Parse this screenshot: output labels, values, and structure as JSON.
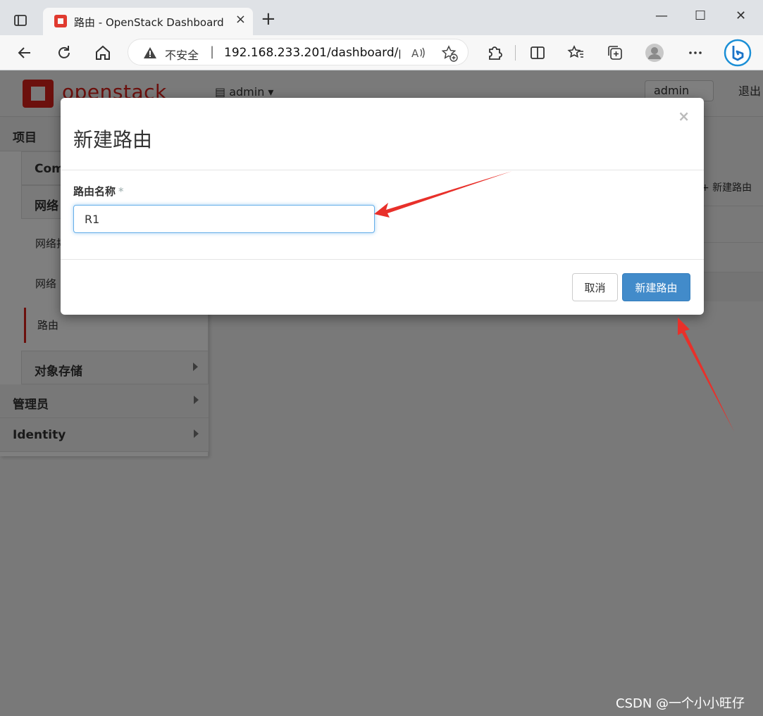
{
  "browser": {
    "tab_title": "路由 - OpenStack Dashboard",
    "tab_close": "×",
    "new_tab": "+",
    "url_warning": "不安全",
    "url_separator": "|",
    "url": "192.168.233.201/dashboard/pr...",
    "window_minimize": "—",
    "window_maximize": "☐",
    "window_close": "✕"
  },
  "header": {
    "logo_text": "openstack",
    "project": "admin",
    "user": "admin",
    "logout": "退出"
  },
  "sidebar": {
    "project": "项目",
    "compute": "Com",
    "network": "网络",
    "network_topology": "网络拓",
    "networks": "网络",
    "routers": "路由",
    "object_storage": "对象存储",
    "admin": "管理员",
    "identity": "Identity"
  },
  "main": {
    "create_router_action": "+ 新建路由"
  },
  "modal": {
    "title": "新建路由",
    "close": "×",
    "name_label": "路由名称",
    "required_mark": "*",
    "name_value": "R1",
    "cancel": "取消",
    "submit": "新建路由"
  },
  "watermark": "CSDN @一个小小旺仔",
  "colors": {
    "openstack_red": "#d8201a",
    "primary_button": "#428bca",
    "annotation_arrow": "#e8302a"
  }
}
